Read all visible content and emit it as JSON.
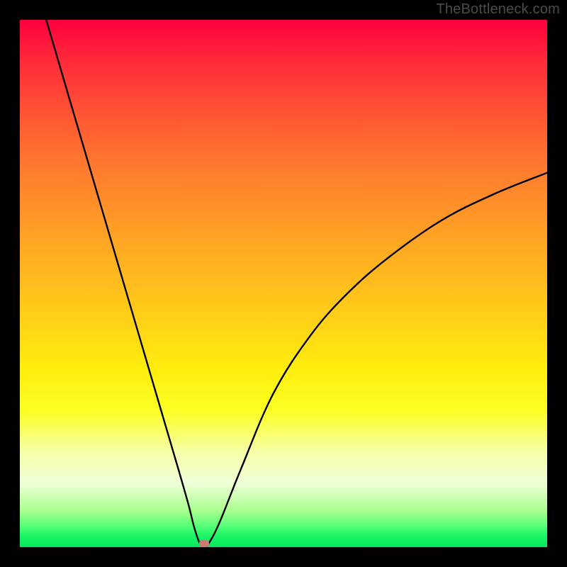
{
  "watermark": "TheBottleneck.com",
  "chart_data": {
    "type": "line",
    "title": "",
    "xlabel": "",
    "ylabel": "",
    "xlim": [
      0,
      100
    ],
    "ylim": [
      0,
      100
    ],
    "grid": false,
    "series": [
      {
        "name": "bottleneck-curve",
        "x": [
          5,
          10,
          15,
          20,
          25,
          30,
          32,
          33,
          34,
          35,
          36,
          38,
          42,
          48,
          55,
          62,
          70,
          80,
          90,
          100
        ],
        "values": [
          100,
          83,
          66,
          49,
          32,
          15,
          8,
          4,
          1,
          0,
          1,
          5,
          15,
          29,
          40,
          48,
          55,
          62,
          67,
          71
        ]
      }
    ],
    "minimum_marker": {
      "x": 35,
      "y": 0
    },
    "gradient_colors": {
      "top": "#ff003e",
      "bottom": "#05e85b"
    }
  }
}
